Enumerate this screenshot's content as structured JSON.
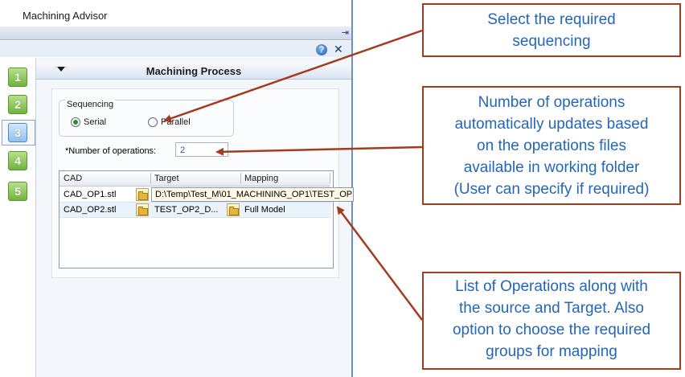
{
  "window": {
    "title": "Machining Advisor"
  },
  "toolbar": {
    "pin_icon": "pin-icon",
    "help_icon": "help-icon",
    "help_glyph": "?",
    "close_icon": "close-icon",
    "close_glyph": "✕"
  },
  "steps": [
    "1",
    "2",
    "3",
    "4",
    "5"
  ],
  "active_step": "3",
  "panel": {
    "title": "Machining Process"
  },
  "sequencing": {
    "legend": "Sequencing",
    "options": [
      {
        "label": "Serial",
        "checked": true
      },
      {
        "label": "Parallel",
        "checked": false
      }
    ]
  },
  "operations": {
    "label": "*Number of operations:",
    "value": "2"
  },
  "grid": {
    "columns": [
      "CAD",
      "Target",
      "Mapping"
    ],
    "rows": [
      {
        "cad": "CAD_OP1.stl",
        "target": "D:\\Temp\\Test_M\\01_MACHINING_OP1\\TEST_OP",
        "mapping": ""
      },
      {
        "cad": "CAD_OP2.stl",
        "target": "TEST_OP2_D...",
        "mapping": "Full Model"
      }
    ]
  },
  "callouts": [
    {
      "lines": [
        "Select the required",
        "sequencing"
      ]
    },
    {
      "lines": [
        "Number of operations",
        "automatically updates based",
        "on the operations files",
        "available in working folder",
        "(User can specify if required)"
      ]
    },
    {
      "lines": [
        "List of Operations along with",
        "the source and Target. Also",
        "option to choose the required",
        "groups for mapping"
      ]
    }
  ],
  "colors": {
    "callout_border": "#a33b1c",
    "callout_text": "#2366b8",
    "step_green": "#6fb43f",
    "step_active": "#8fc0ef"
  }
}
